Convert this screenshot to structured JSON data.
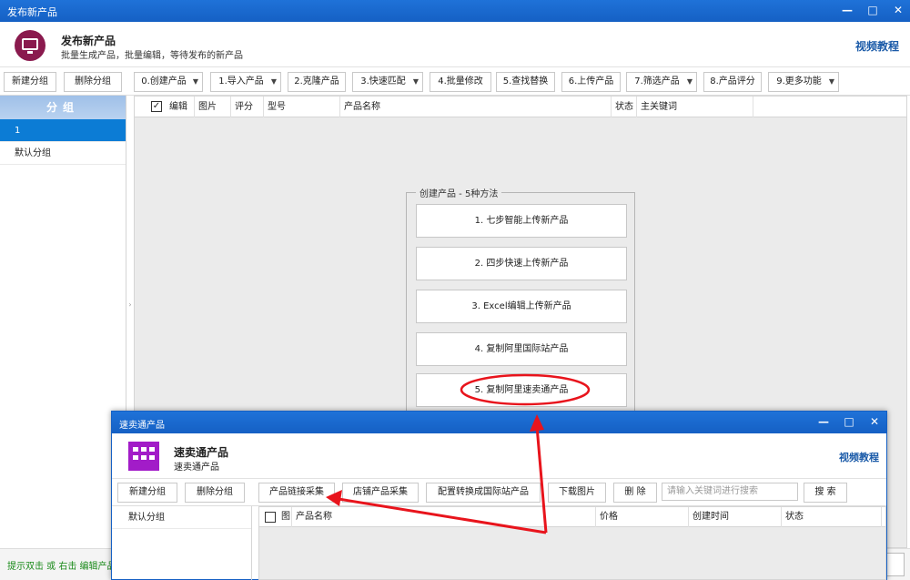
{
  "window": {
    "title": "发布新产品",
    "controls": [
      "—",
      "□",
      "✕"
    ]
  },
  "header": {
    "title": "发布新产品",
    "subtitle": "批量生成产品，批量编辑，等待发布的新产品",
    "video_link": "视频教程"
  },
  "toolbar": {
    "new_group": "新建分组",
    "delete_group": "删除分组",
    "create": "0.创建产品",
    "import": "1.导入产品",
    "clone": "2.克隆产品",
    "match": "3.快速匹配",
    "batch_edit": "4.批量修改",
    "find_replace": "5.查找替换",
    "upload": "6.上传产品",
    "filter": "7.筛选产品",
    "score": "8.产品评分",
    "more": "9.更多功能"
  },
  "sidebar": {
    "header": "分组",
    "items": [
      {
        "label": "1"
      },
      {
        "label": "默认分组"
      }
    ]
  },
  "table": {
    "check": "✓",
    "columns": [
      "编辑",
      "图片",
      "评分",
      "型号",
      "产品名称",
      "状态",
      "主关键词"
    ]
  },
  "methods": {
    "legend": "创建产品 - 5种方法",
    "items": [
      {
        "label": "1. 七步智能上传新产品"
      },
      {
        "label": "2. 四步快速上传新产品"
      },
      {
        "label": "3. Excel编辑上传新产品"
      },
      {
        "label": "4. 复制阿里国际站产品"
      },
      {
        "label": "5. 复制阿里速卖通产品"
      }
    ]
  },
  "status": {
    "text": "提示双击 或 右击 编辑产品"
  },
  "child": {
    "title": "速卖通产品",
    "controls": [
      "—",
      "□",
      "✕"
    ],
    "header_title": "速卖通产品",
    "header_subtitle": "速卖通产品",
    "video_link": "视频教程",
    "toolbar": {
      "new_group": "新建分组",
      "delete_group": "删除分组",
      "link_collect": "产品链接采集",
      "shop_collect": "店铺产品采集",
      "convert": "配置转换成国际站产品",
      "download_images": "下载图片",
      "delete": "删 除",
      "search_placeholder": "请输入关键词进行搜索",
      "search": "搜 索"
    },
    "sidebar_items": [
      {
        "label": "默认分组"
      }
    ],
    "columns": [
      "图",
      "产品名称",
      "价格",
      "创建时间",
      "状态"
    ]
  },
  "colors": {
    "titlebar": "#1560c4",
    "selected": "#0c7cd5",
    "annotation": "#e8141c",
    "link": "#1a5aa8"
  }
}
